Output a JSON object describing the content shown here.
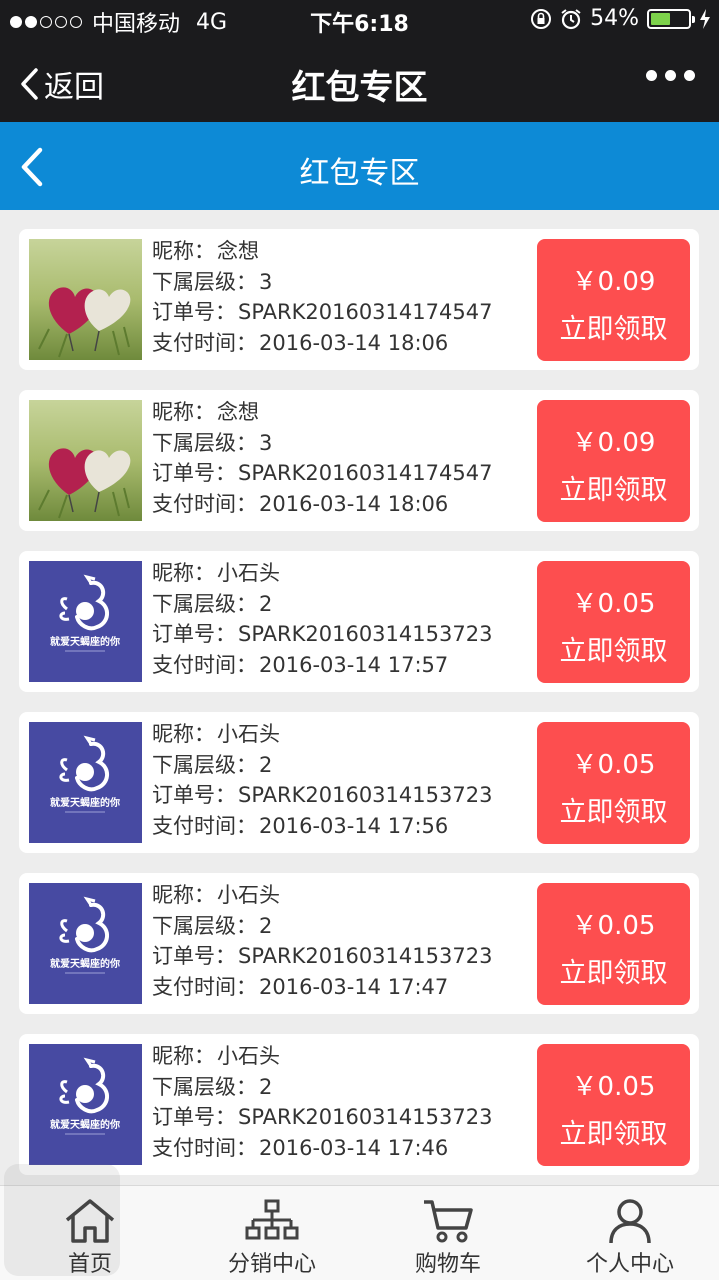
{
  "status_bar": {
    "carrier": "中国移动",
    "network": "4G",
    "time": "下午6:18",
    "battery": "54%",
    "battery_level": 0.54
  },
  "navbar": {
    "back_label": "返回",
    "title": "红包专区"
  },
  "header": {
    "title": "红包专区"
  },
  "labels": {
    "nickname": "昵称：",
    "level": "下属层级：",
    "order": "订单号：",
    "pay_time": "支付时间：",
    "claim": "立即领取"
  },
  "items": [
    {
      "nickname": "念想",
      "level": "3",
      "order": "SPARK20160314174547",
      "pay_time": "2016-03-14 18:06",
      "amount": "￥0.09",
      "avatar": "hearts"
    },
    {
      "nickname": "念想",
      "level": "3",
      "order": "SPARK20160314174547",
      "pay_time": "2016-03-14 18:06",
      "amount": "￥0.09",
      "avatar": "hearts"
    },
    {
      "nickname": "小石头",
      "level": "2",
      "order": "SPARK20160314153723",
      "pay_time": "2016-03-14 17:57",
      "amount": "￥0.05",
      "avatar": "scorpio"
    },
    {
      "nickname": "小石头",
      "level": "2",
      "order": "SPARK20160314153723",
      "pay_time": "2016-03-14 17:56",
      "amount": "￥0.05",
      "avatar": "scorpio"
    },
    {
      "nickname": "小石头",
      "level": "2",
      "order": "SPARK20160314153723",
      "pay_time": "2016-03-14 17:47",
      "amount": "￥0.05",
      "avatar": "scorpio"
    },
    {
      "nickname": "小石头",
      "level": "2",
      "order": "SPARK20160314153723",
      "pay_time": "2016-03-14 17:46",
      "amount": "￥0.05",
      "avatar": "scorpio"
    }
  ],
  "avatar_text": "就爱天蝎座的你",
  "tabbar": {
    "items": [
      {
        "label": "首页",
        "icon": "home-icon"
      },
      {
        "label": "分销中心",
        "icon": "org-chart-icon"
      },
      {
        "label": "购物车",
        "icon": "cart-icon"
      },
      {
        "label": "个人中心",
        "icon": "user-icon"
      }
    ]
  },
  "colors": {
    "nav_dark": "#1b1b1d",
    "header_blue": "#0d8ad6",
    "claim_red": "#fd4e4f",
    "page_bg": "#ededed"
  }
}
